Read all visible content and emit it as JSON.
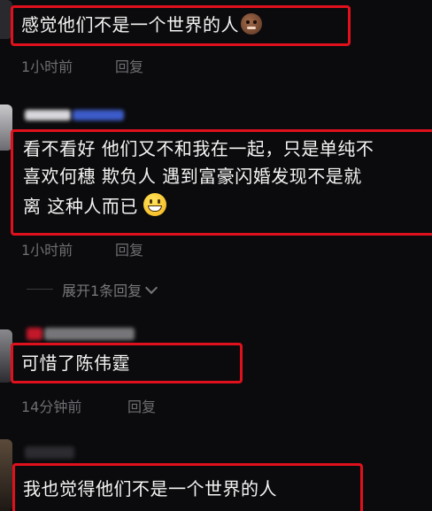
{
  "comments": [
    {
      "text": "感觉他们不是一个世界的人",
      "emoji": "cookie-face-emoji",
      "time": "1小时前",
      "reply_label": "回复"
    },
    {
      "lines": [
        "看不看好 他们又不和我在一起，只是单纯不",
        "喜欢何穗 欺负人 遇到富豪闪婚发现不是就",
        "离 这种人而已"
      ],
      "emoji": "grinning-face-emoji",
      "time": "1小时前",
      "reply_label": "回复",
      "expand_label": "展开1条回复"
    },
    {
      "text": "可惜了陈伟霆",
      "time": "14分钟前",
      "reply_label": "回复"
    },
    {
      "text": "我也觉得他们不是一个世界的人"
    }
  ],
  "colors": {
    "background": "#0b0b0d",
    "highlight_frame": "#e0101c",
    "meta_text": "#6e6e72"
  }
}
